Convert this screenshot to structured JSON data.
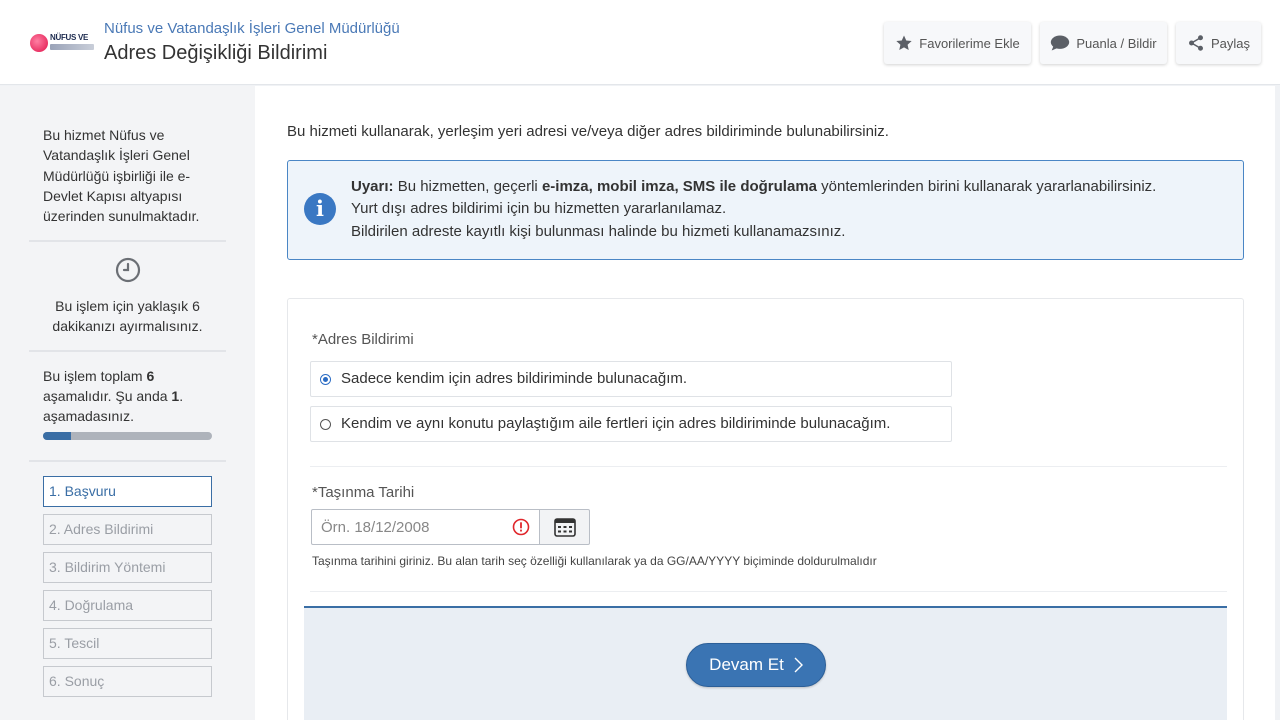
{
  "header": {
    "logo_text": "NÜFUS VE",
    "org_name": "Nüfus ve Vatandaşlık İşleri Genel Müdürlüğü",
    "title": "Adres Değişikliği Bildirimi",
    "buttons": {
      "favorite": "Favorilerime Ekle",
      "rate": "Puanla / Bildir",
      "share": "Paylaş"
    }
  },
  "sidebar": {
    "intro": "Bu hizmet Nüfus ve Vatandaşlık İşleri Genel Müdürlüğü işbirliği ile e-Devlet Kapısı altyapısı üzerinden sunulmaktadır.",
    "time_text": "Bu işlem için yaklaşık 6 dakikanızı ayırmalısınız.",
    "steps_prefix": "Bu işlem toplam ",
    "total_steps": "6",
    "steps_middle": " aşamalıdır. Şu anda ",
    "current_step": "1",
    "steps_suffix": ". aşamadasınız.",
    "progress_fraction": 0.167,
    "steps": [
      {
        "label": "1. Başvuru"
      },
      {
        "label": "2. Adres Bildirimi"
      },
      {
        "label": "3. Bildirim Yöntemi"
      },
      {
        "label": "4. Doğrulama"
      },
      {
        "label": "5. Tescil"
      },
      {
        "label": "6. Sonuç"
      }
    ]
  },
  "main": {
    "intro": "Bu hizmeti kullanarak, yerleşim yeri adresi ve/veya diğer adres bildiriminde bulunabilirsiniz.",
    "alert": {
      "label": "Uyarı:",
      "line1_a": " Bu hizmetten, geçerli ",
      "line1_b": "e-imza, mobil imza, SMS ile doğrulama",
      "line1_c": " yöntemlerinden birini kullanarak yararlanabilirsiniz.",
      "line2": "Yurt dışı adres bildirimi için bu hizmetten yararlanılamaz.",
      "line3": "Bildirilen adreste kayıtlı kişi bulunması halinde bu hizmeti kullanamazsınız."
    },
    "form": {
      "address_label": "*Adres Bildirimi",
      "option_self": "Sadece kendim için adres bildiriminde bulunacağım.",
      "option_family": "Kendim ve aynı konutu paylaştığım aile fertleri için adres bildiriminde bulunacağım.",
      "date_label": "*Taşınma Tarihi",
      "date_placeholder": "Örn. 18/12/2008",
      "date_value": "",
      "date_hint": "Taşınma tarihini giriniz. Bu alan tarih seç özelliği kullanılarak ya da GG/AA/YYYY biçiminde doldurulmalıdır",
      "submit": "Devam Et"
    }
  },
  "colors": {
    "accent": "#3a6ea5",
    "link": "#4a79b6",
    "error": "#e0262b"
  }
}
